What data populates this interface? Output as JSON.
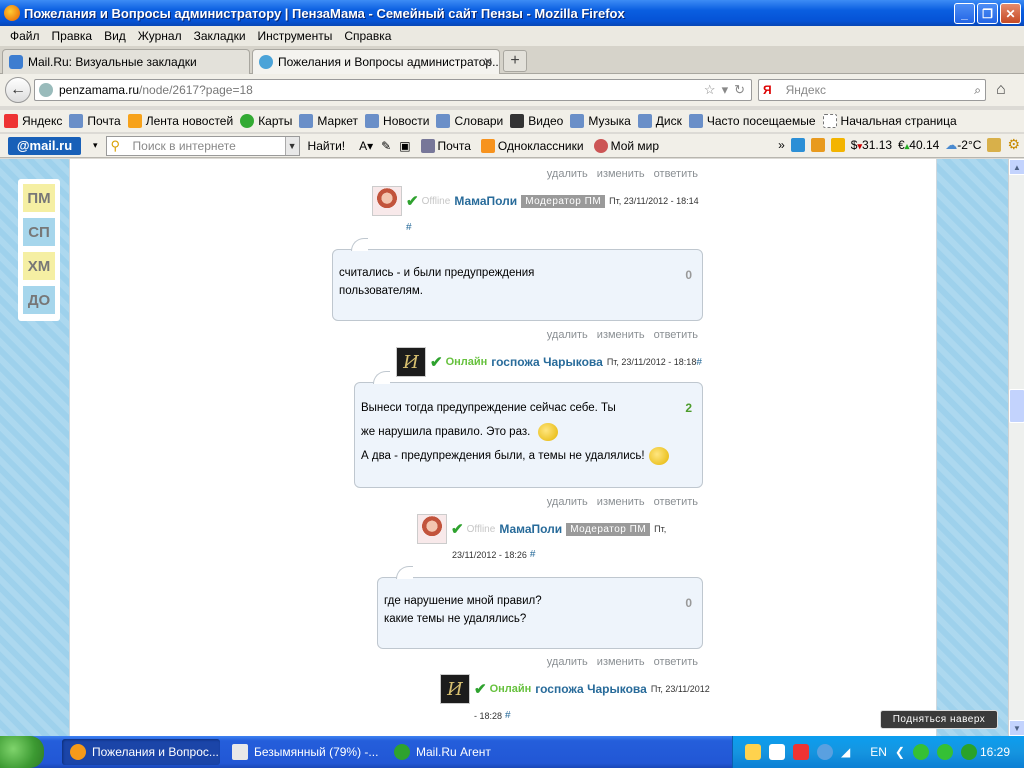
{
  "window": {
    "title": "Пожелания и Вопросы администратору | ПензаМама - Семейный сайт Пензы - Mozilla Firefox"
  },
  "menu": [
    "Файл",
    "Правка",
    "Вид",
    "Журнал",
    "Закладки",
    "Инструменты",
    "Справка"
  ],
  "tabs": [
    {
      "label": "Mail.Ru: Визуальные закладки"
    },
    {
      "label": "Пожелания и Вопросы администратор..."
    }
  ],
  "nav": {
    "url_host": "penzamama.ru",
    "url_path": "/node/2617?page=18",
    "search_placeholder": "Яндекс",
    "search_engine": "Я"
  },
  "bookmarks": [
    "Яндекс",
    "Почта",
    "Лента новостей",
    "Карты",
    "Маркет",
    "Новости",
    "Словари",
    "Видео",
    "Музыка",
    "Диск",
    "Часто посещаемые",
    "Начальная страница"
  ],
  "mailbar": {
    "logo": "@mail.ru",
    "search_placeholder": "Поиск в интернете",
    "find": "Найти!",
    "items": [
      "Почта",
      "Одноклассники",
      "Мой мир"
    ],
    "dollar": "31.13",
    "euro": "40.14",
    "weather": "-2°C"
  },
  "sidenav": [
    "ПМ",
    "СП",
    "ХМ",
    "ДО"
  ],
  "actions": {
    "delete": "удалить",
    "edit": "изменить",
    "reply": "ответить"
  },
  "comments": [
    {
      "status": "Offline",
      "user": "МамаПоли",
      "role": "Модератор ПМ",
      "date": "Пт, 23/11/2012 - 18:14",
      "hash": "#",
      "lines": [
        "считались - и были предупреждения",
        "пользователям."
      ],
      "score": "0"
    },
    {
      "status": "Онлайн",
      "user": "госпожа Чарыкова",
      "date": "Пт, 23/11/2012 - 18:18",
      "hash": "#",
      "lines": [
        "Вынеси тогда предупреждение сейчас себе. Ты",
        "же нарушила правило. Это раз.",
        "А два - предупреждения были, а темы не удалялись!"
      ],
      "score": "2"
    },
    {
      "status": "Offline",
      "user": "МамаПоли",
      "role": "Модератор ПМ",
      "date_a": "Пт,",
      "date_b": "23/11/2012 - 18:26",
      "hash": "#",
      "lines": [
        "где нарушение мной правил?",
        "какие темы не удалялись?"
      ],
      "score": "0"
    },
    {
      "status": "Онлайн",
      "user": "госпожа Чарыкова",
      "date_a": "Пт, 23/11/2012",
      "date_b": "- 18:28",
      "hash": "#"
    }
  ],
  "avatar_letter": "И",
  "scroll_top": "Подняться наверх",
  "taskbar": {
    "tasks": [
      "Пожелания и Вопрос...",
      "Безымянный (79%) -...",
      "Mail.Ru Агент"
    ],
    "lang": "EN",
    "clock": "16:29"
  }
}
